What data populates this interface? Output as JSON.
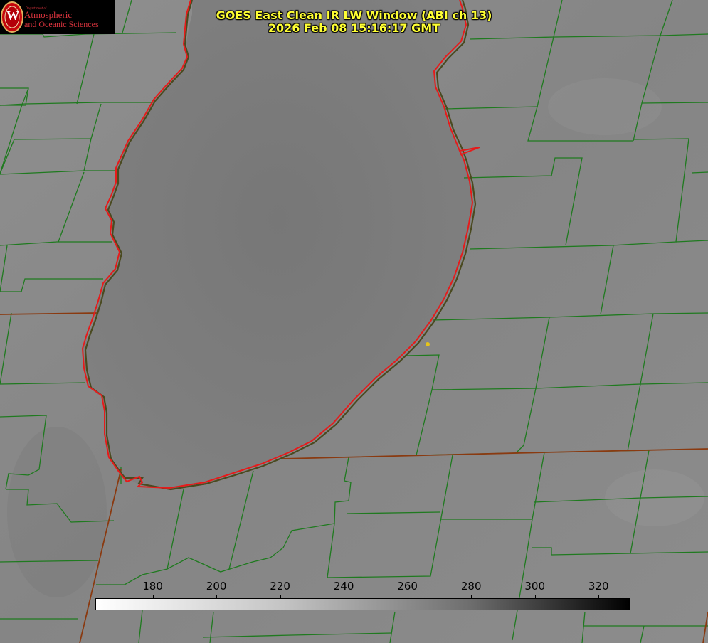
{
  "header": {
    "title_line1": "GOES East Clean IR LW Window (ABI ch 13)",
    "title_line2": "2026 Feb 08 15:16:17 GMT"
  },
  "logo": {
    "dept_small": "Department of",
    "line1": "Atmospheric",
    "line2": "and Oceanic Sciences",
    "seal_letter": "W"
  },
  "colorbar": {
    "ticks": [
      "180",
      "200",
      "220",
      "240",
      "260",
      "280",
      "300",
      "320"
    ],
    "range": [
      162,
      330
    ],
    "gradient": "white to black"
  },
  "colors": {
    "background": "#8a8a8a",
    "county_lines": "#1f7a1f",
    "state_lines": "#8a3a10",
    "coastline": "#e61b1b",
    "title": "#ffff33",
    "marker": "#e6c419"
  }
}
